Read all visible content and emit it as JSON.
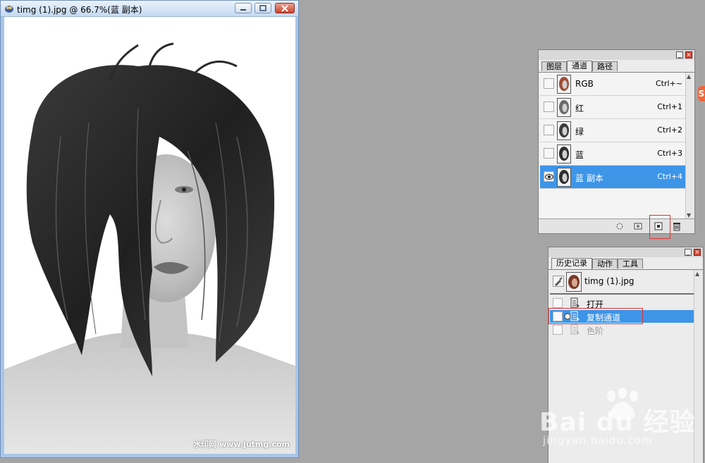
{
  "document": {
    "title": "timg (1).jpg @ 66.7%(蓝 副本)",
    "watermark": "水印网 www.jutmg.com"
  },
  "channels_panel": {
    "tabs": [
      {
        "label": "图层",
        "active": false
      },
      {
        "label": "通道",
        "active": true
      },
      {
        "label": "路径",
        "active": false
      }
    ],
    "menu_glyph": "»",
    "channels": [
      {
        "name": "RGB",
        "shortcut": "Ctrl+~",
        "visible": false,
        "selected": false,
        "tint": "#a14c36"
      },
      {
        "name": "红",
        "shortcut": "Ctrl+1",
        "visible": false,
        "selected": false,
        "tint": "#6b6b6b"
      },
      {
        "name": "绿",
        "shortcut": "Ctrl+2",
        "visible": false,
        "selected": false,
        "tint": "#3c3c3c"
      },
      {
        "name": "蓝",
        "shortcut": "Ctrl+3",
        "visible": false,
        "selected": false,
        "tint": "#2e2e2e"
      },
      {
        "name": "蓝 副本",
        "shortcut": "Ctrl+4",
        "visible": true,
        "selected": true,
        "tint": "#2e2e2e"
      }
    ],
    "footer_icons": [
      "load-selection-icon",
      "save-selection-icon",
      "new-channel-icon",
      "delete-channel-icon"
    ]
  },
  "history_panel": {
    "tabs": [
      {
        "label": "历史记录",
        "active": true
      },
      {
        "label": "动作",
        "active": false
      },
      {
        "label": "工具",
        "active": false
      }
    ],
    "menu_glyph": "»",
    "snapshot": "timg (1).jpg",
    "states": [
      {
        "label": "打开",
        "selected": false,
        "dimmed": false
      },
      {
        "label": "复制通道",
        "selected": true,
        "dimmed": false
      },
      {
        "label": "色阶",
        "selected": false,
        "dimmed": true
      }
    ]
  },
  "watermark": {
    "brand": "Bai du 经验",
    "url": "jingyan.baidu.com"
  },
  "side_tag": "S",
  "colors": {
    "selection": "#3d95e8",
    "highlight": "#e53030",
    "workspace": "#a5a5a5"
  }
}
